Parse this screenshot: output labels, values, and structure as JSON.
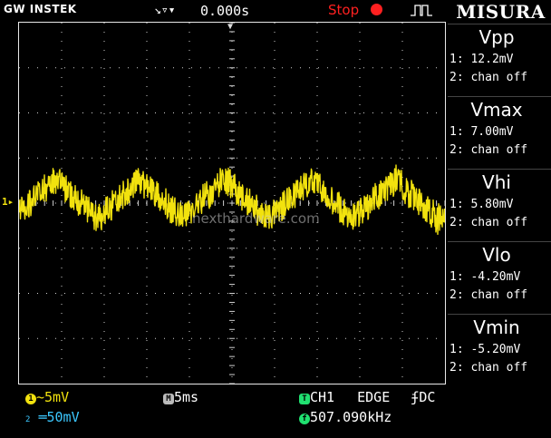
{
  "header": {
    "brand": "GW INSTEK",
    "time_offset": "0.000s",
    "run_state": "Stop",
    "panel_title": "MISURA"
  },
  "colors": {
    "ch1": "#f2e20e",
    "ch2": "#3cc8ff",
    "trigger": "#20e070",
    "stop": "#ff2020",
    "grid": "#d0d0d0"
  },
  "channel_marker": "1",
  "measurements": [
    {
      "title": "Vpp",
      "line1": "1: 12.2mV",
      "line2": "2: chan off"
    },
    {
      "title": "Vmax",
      "line1": "1: 7.00mV",
      "line2": "2: chan off"
    },
    {
      "title": "Vhi",
      "line1": "1: 5.80mV",
      "line2": "2: chan off"
    },
    {
      "title": "Vlo",
      "line1": "1: -4.20mV",
      "line2": "2: chan off"
    },
    {
      "title": "Vmin",
      "line1": "1: -5.20mV",
      "line2": "2: chan off"
    }
  ],
  "bottom": {
    "ch1_badge": "1",
    "ch1_coupling": "~",
    "ch1_scale": "5mV",
    "ch2_badge": "2",
    "ch2_coupling": "═",
    "ch2_scale": "50mV",
    "timebase_badge": "M",
    "timebase": "5ms",
    "trig_badge": "T",
    "trig_source": "CH1",
    "trig_type": "EDGE",
    "trig_coupling": "DC",
    "freq_badge": "f",
    "frequency": "507.090kHz"
  },
  "watermark": "nexthardware.com"
}
